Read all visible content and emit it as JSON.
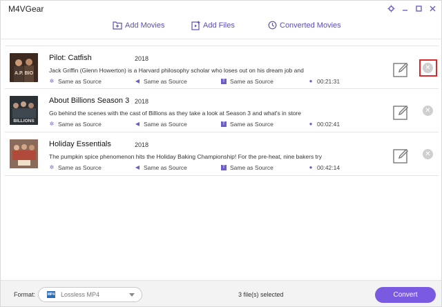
{
  "app": {
    "title": "M4VGear"
  },
  "toolbar": {
    "add_movies": "Add Movies",
    "add_files": "Add Files",
    "converted_movies": "Converted Movies"
  },
  "items": [
    {
      "title": "Pilot: Catfish",
      "year": "2018",
      "description": "Jack Griffin (Glenn Howerton) is a Harvard philosophy scholar who loses out on his dream job and",
      "video": "Same as Source",
      "audio": "Same as Source",
      "subtitle": "Same as Source",
      "duration": "00:21:31",
      "thumb_color": "#5a3a28"
    },
    {
      "title": "About Billions Season 3",
      "year": "2018",
      "description": "Go behind the scenes with the cast of Billions as they take a look at Season 3 and what's in store",
      "video": "Same as Source",
      "audio": "Same as Source",
      "subtitle": "Same as Source",
      "duration": "00:02:41",
      "thumb_color": "#2e3338"
    },
    {
      "title": "Holiday Essentials",
      "year": "2018",
      "description": "The pumpkin spice phenomenon hits the Holiday Baking Championship! For the pre-heat, nine bakers try",
      "video": "Same as Source",
      "audio": "Same as Source",
      "subtitle": "Same as Source",
      "duration": "00:42:14",
      "thumb_color": "#7a5548"
    }
  ],
  "footer": {
    "format_label": "Format:",
    "format_value": "Lossless MP4",
    "format_badge": "MP4",
    "status": "3 file(s) selected",
    "convert": "Convert"
  },
  "colors": {
    "accent": "#7a5ae0",
    "icon": "#5a4db8",
    "highlight": "#d92a2a"
  }
}
